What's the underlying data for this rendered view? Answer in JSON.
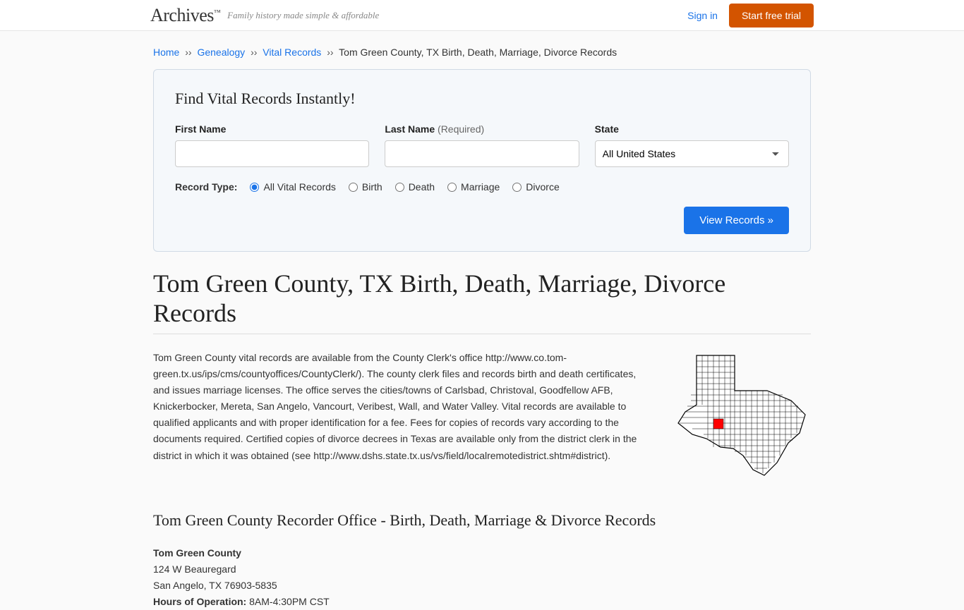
{
  "header": {
    "logo": "Archives",
    "tagline": "Family history made simple & affordable",
    "signin": "Sign in",
    "cta": "Start free trial"
  },
  "breadcrumb": {
    "home": "Home",
    "genealogy": "Genealogy",
    "vital": "Vital Records",
    "current": "Tom Green County, TX Birth, Death, Marriage, Divorce Records",
    "sep": "››"
  },
  "search": {
    "title": "Find Vital Records Instantly!",
    "first_label": "First Name",
    "last_label": "Last Name",
    "last_required": "(Required)",
    "state_label": "State",
    "state_value": "All United States",
    "record_type_label": "Record Type:",
    "options": {
      "all": "All Vital Records",
      "birth": "Birth",
      "death": "Death",
      "marriage": "Marriage",
      "divorce": "Divorce"
    },
    "submit": "View Records »"
  },
  "main": {
    "title": "Tom Green County, TX Birth, Death, Marriage, Divorce Records",
    "body": "Tom Green County vital records are available from the County Clerk's office http://www.co.tom-green.tx.us/ips/cms/countyoffices/CountyClerk/). The county clerk files and records birth and death certificates, and issues marriage licenses. The office serves the cities/towns of Carlsbad, Christoval, Goodfellow AFB, Knickerbocker, Mereta, San Angelo, Vancourt, Veribest, Wall, and Water Valley. Vital records are available to qualified applicants and with proper identification for a fee. Fees for copies of records vary according to the documents required. Certified copies of divorce decrees in Texas are available only from the district clerk in the district in which it was obtained (see http://www.dshs.state.tx.us/vs/field/localremotedistrict.shtm#district).",
    "section_title": "Tom Green County Recorder Office - Birth, Death, Marriage & Divorce Records",
    "office": {
      "name": "Tom Green County",
      "street": "124 W Beauregard",
      "city_state_zip": "San Angelo, TX 76903-5835",
      "hours_label": "Hours of Operation:",
      "hours_value": "8AM-4:30PM CST"
    }
  }
}
